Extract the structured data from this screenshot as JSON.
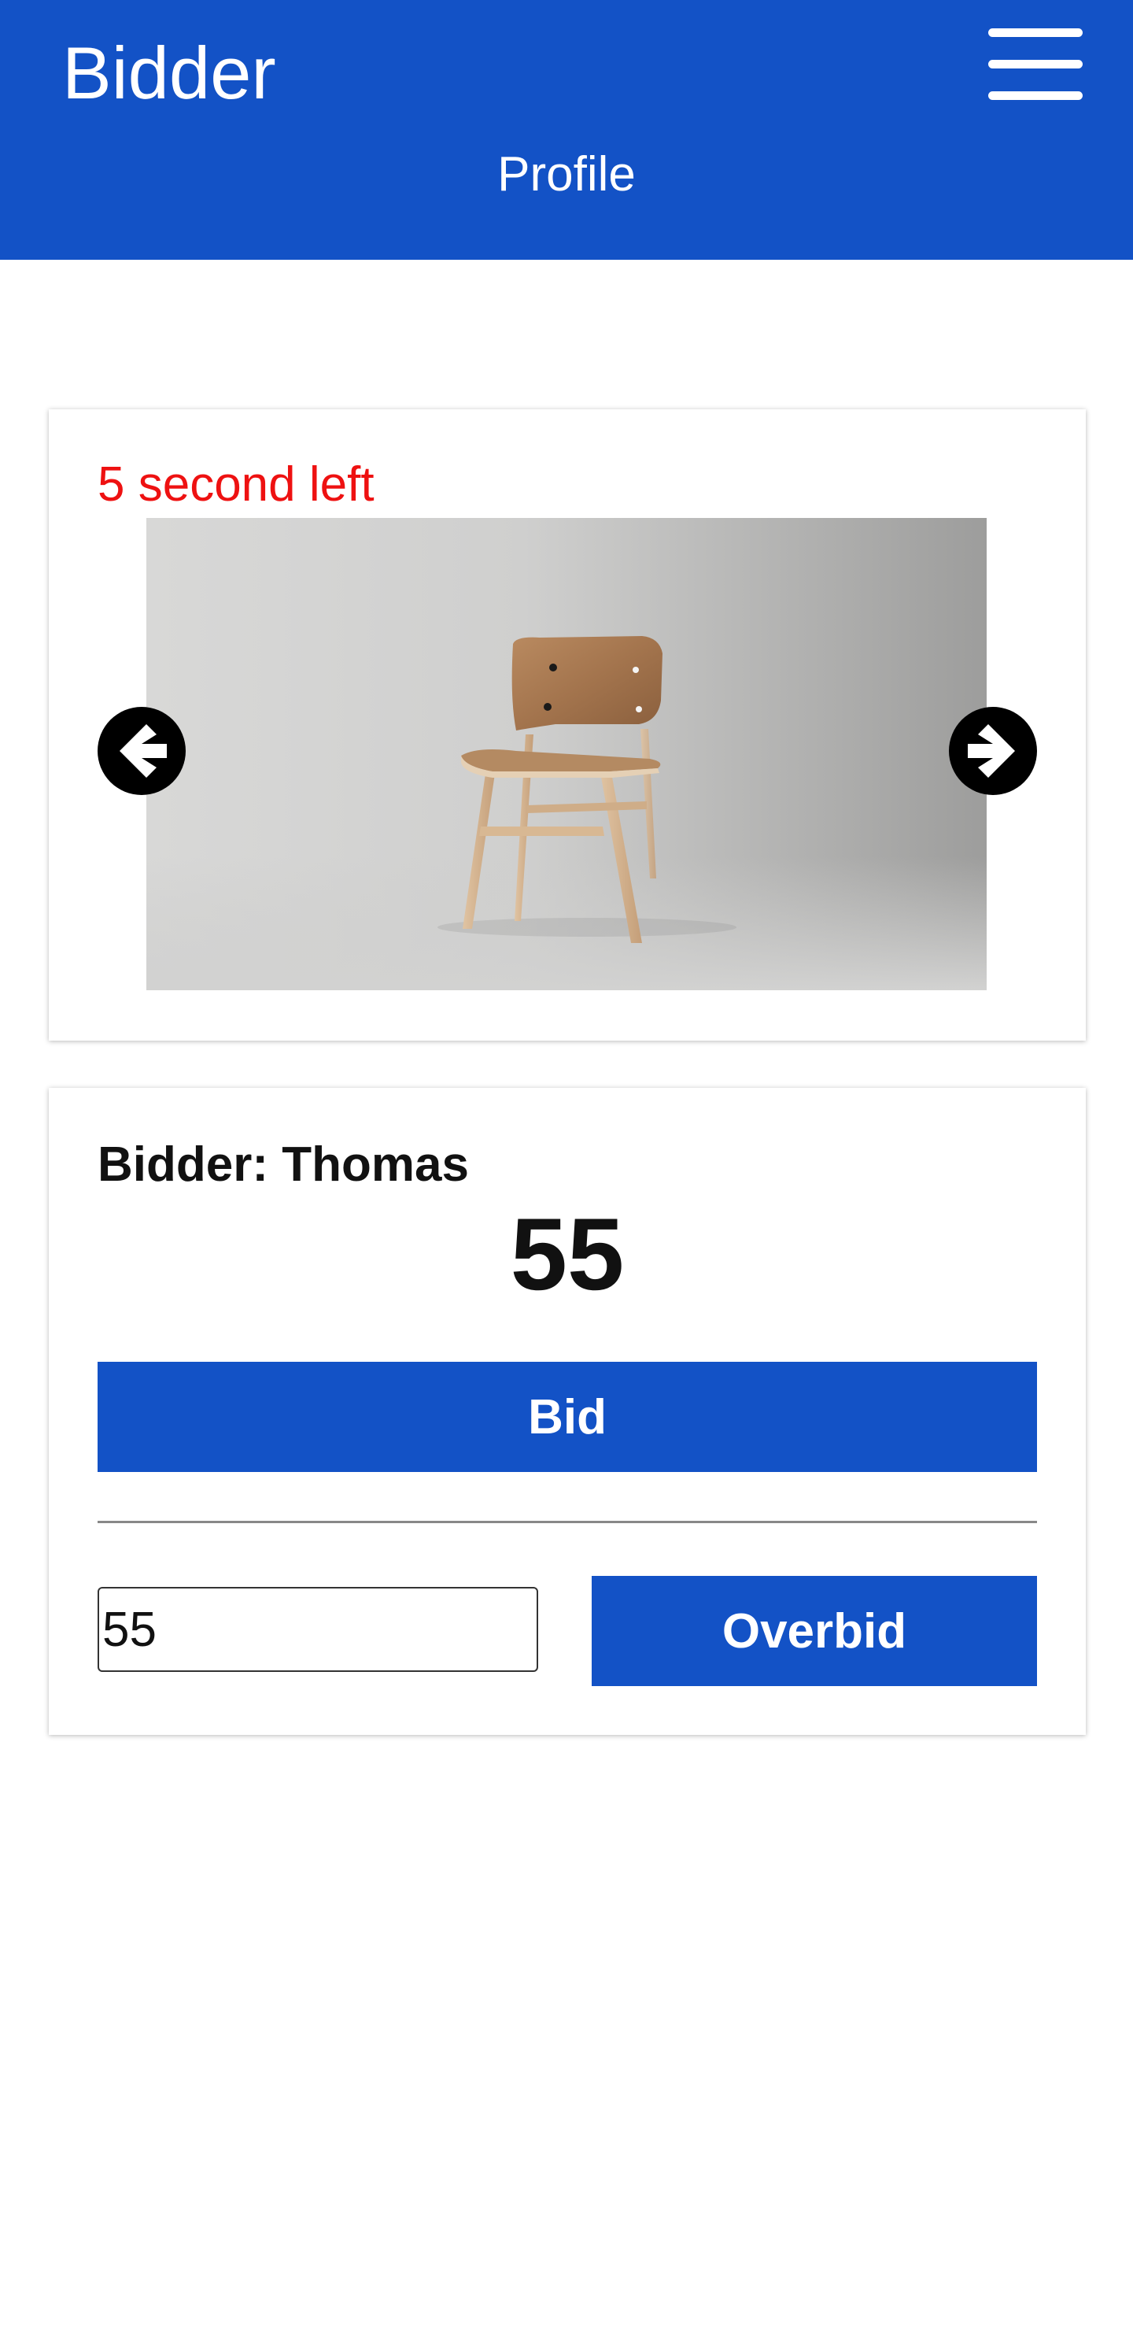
{
  "header": {
    "app_title": "Bidder",
    "nav_link": "Profile",
    "menu_icon": "hamburger-menu-icon",
    "background_color": "#1352c6"
  },
  "auction": {
    "timer_text": "5 second left",
    "timer_color": "#ee1111",
    "image_subject": "wooden chair",
    "prev_icon": "arrow-left-circle-icon",
    "next_icon": "arrow-right-circle-icon"
  },
  "bid": {
    "bidder_label": "Bidder:",
    "bidder_name": "Thomas",
    "current_amount": "55",
    "bid_button_label": "Bid",
    "amount_input_value": "55",
    "overbid_button_label": "Overbid",
    "accent_color": "#1352c6"
  }
}
